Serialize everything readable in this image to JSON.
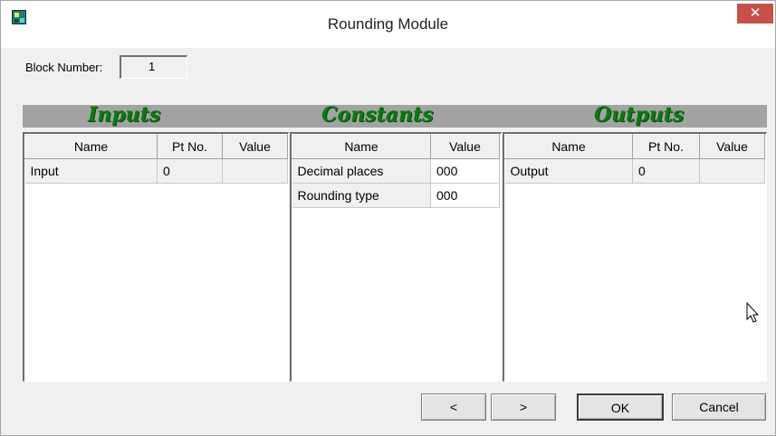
{
  "window": {
    "title": "Rounding Module",
    "close_label": "✕",
    "icon": "app-icon"
  },
  "block": {
    "label": "Block Number:",
    "value": "1"
  },
  "sections": {
    "inputs": "Inputs",
    "constants": "Constants",
    "outputs": "Outputs"
  },
  "inputs": {
    "columns": [
      "Name",
      "Pt No.",
      "Value"
    ],
    "rows": [
      {
        "name": "Input",
        "pt": "0",
        "value": ""
      }
    ]
  },
  "constants": {
    "columns": [
      "Name",
      "Value"
    ],
    "rows": [
      {
        "name": "Decimal places",
        "value": "000"
      },
      {
        "name": "Rounding type",
        "value": "000"
      }
    ]
  },
  "outputs": {
    "columns": [
      "Name",
      "Pt No.",
      "Value"
    ],
    "rows": [
      {
        "name": "Output",
        "pt": "0",
        "value": ""
      }
    ]
  },
  "buttons": {
    "prev": "<",
    "next": ">",
    "ok": "OK",
    "cancel": "Cancel"
  },
  "colors": {
    "section_title": "#0a7a10",
    "header_bar": "#a3a3a3",
    "close_button": "#c7504a"
  }
}
